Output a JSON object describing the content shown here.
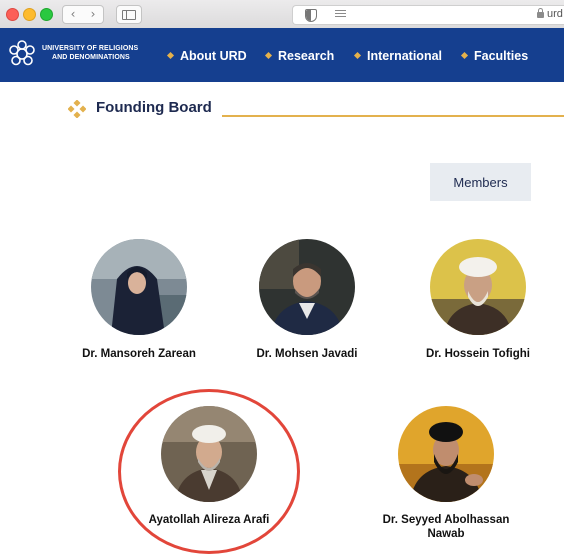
{
  "browser": {
    "url_text": "urd",
    "back_glyph": "‹",
    "forward_glyph": "›"
  },
  "site": {
    "logo_line1": "UNIVERSITY OF RELIGIONS",
    "logo_line2": "AND DENOMINATIONS",
    "nav": [
      {
        "label": "About URD"
      },
      {
        "label": "Research"
      },
      {
        "label": "International"
      },
      {
        "label": "Faculties"
      }
    ]
  },
  "section": {
    "title": "Founding Board",
    "members_label": "Members"
  },
  "members": [
    {
      "name": "Dr. Mansoreh Zarean",
      "icon": "woman-chador-portrait"
    },
    {
      "name": "Dr. Mohsen Javadi",
      "icon": "man-suit-portrait"
    },
    {
      "name": "Dr. Hossein Tofighi",
      "icon": "cleric-white-turban-portrait"
    },
    {
      "name": "Ayatollah Alireza Arafi",
      "icon": "cleric-white-turban-portrait"
    },
    {
      "name": "Dr. Seyyed Abolhassan Nawab",
      "icon": "cleric-black-turban-portrait"
    }
  ],
  "colors": {
    "nav_bg": "#153f8f",
    "accent_gold": "#e3b14d",
    "highlight_circle": "#e2463a",
    "members_button_bg": "#e8ecf1"
  }
}
